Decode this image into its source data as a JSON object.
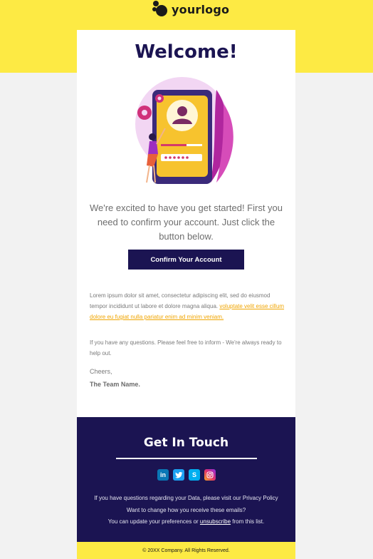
{
  "header": {
    "logo_text": "yourlogo"
  },
  "card": {
    "title": "Welcome!",
    "intro": "We're excited to have you get started! First you need to confirm your account. Just click the button below.",
    "cta_label": "Confirm Your Account",
    "paragraph1_text": "Lorem ipsum dolor sit amet, consectetur adipiscing elit, sed do eiusmod tempor incididunt ut labore et dolore magna aliqua.",
    "paragraph1_link": "voluptate velit esse cillum dolore eu fugiat nulla pariatur enim ad minim veniam.",
    "paragraph2": "If you have any questions. Please feel free to inform - We're always ready to help out.",
    "signoff": "Cheers,",
    "team": "The Team Name."
  },
  "footer": {
    "title": "Get In Touch",
    "socials": [
      "linkedin-icon",
      "twitter-icon",
      "skype-icon",
      "instagram-icon"
    ],
    "line1": "If you have questions regarding your Data, please visit our Privacy Policy",
    "line2": "Want to change how you receive these emails?",
    "line3_prefix": "You can update your preferences or",
    "line3_link": "unsubscribe",
    "line3_suffix": "from this list.",
    "copyright": "© 20XX Company. All Rights Reserved."
  },
  "colors": {
    "brand_yellow": "#fdea44",
    "navy": "#1b1452",
    "link_orange": "#f0a500"
  }
}
